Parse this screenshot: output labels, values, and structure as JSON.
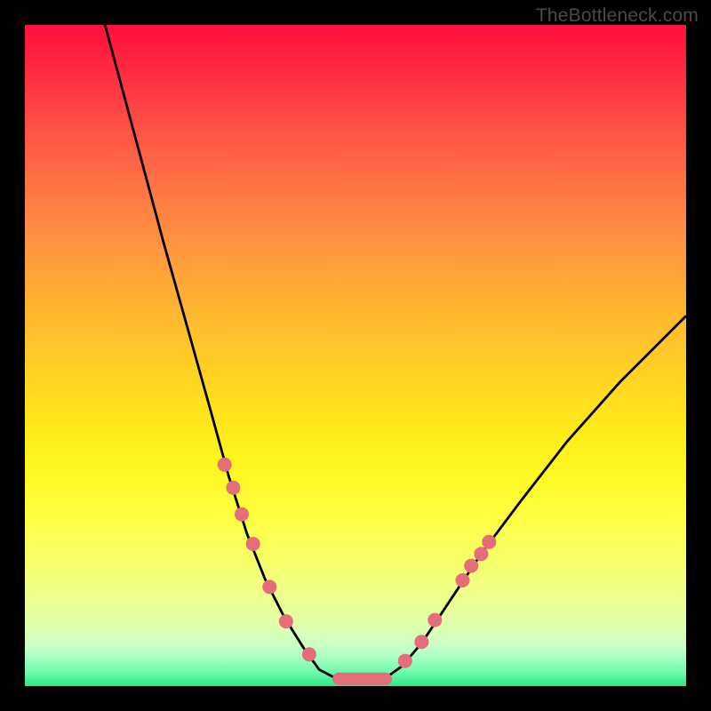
{
  "watermark": "TheBottleneck.com",
  "chart_data": {
    "type": "line",
    "title": "",
    "xlabel": "",
    "ylabel": "",
    "xlim": [
      0,
      1
    ],
    "ylim": [
      0,
      1
    ],
    "series": [
      {
        "name": "left-branch",
        "x": [
          0.105,
          0.14,
          0.175,
          0.21,
          0.245,
          0.28,
          0.308,
          0.336,
          0.364,
          0.392,
          0.42,
          0.445,
          0.47
        ],
        "y": [
          1.06,
          0.93,
          0.8,
          0.67,
          0.545,
          0.42,
          0.318,
          0.23,
          0.16,
          0.105,
          0.06,
          0.025,
          0.012
        ]
      },
      {
        "name": "flat-bottom",
        "x": [
          0.47,
          0.51,
          0.545
        ],
        "y": [
          0.012,
          0.01,
          0.012
        ]
      },
      {
        "name": "right-branch",
        "x": [
          0.545,
          0.57,
          0.6,
          0.64,
          0.69,
          0.75,
          0.82,
          0.9,
          1.0
        ],
        "y": [
          0.012,
          0.03,
          0.065,
          0.125,
          0.2,
          0.28,
          0.37,
          0.46,
          0.56
        ]
      }
    ],
    "markers_left": [
      [
        0.302,
        0.335
      ],
      [
        0.315,
        0.3
      ],
      [
        0.328,
        0.26
      ],
      [
        0.345,
        0.215
      ],
      [
        0.37,
        0.15
      ],
      [
        0.395,
        0.098
      ],
      [
        0.43,
        0.048
      ]
    ],
    "markers_right": [
      [
        0.575,
        0.038
      ],
      [
        0.6,
        0.067
      ],
      [
        0.62,
        0.1
      ],
      [
        0.662,
        0.16
      ],
      [
        0.675,
        0.182
      ],
      [
        0.69,
        0.2
      ],
      [
        0.702,
        0.218
      ]
    ],
    "markers_bottom_bar": {
      "x0": 0.465,
      "x1": 0.555,
      "y": 0.011
    },
    "colors": {
      "curve": "#000000",
      "marker_fill": "#e56d7a",
      "bottom_bar": "#e56d7a"
    }
  }
}
